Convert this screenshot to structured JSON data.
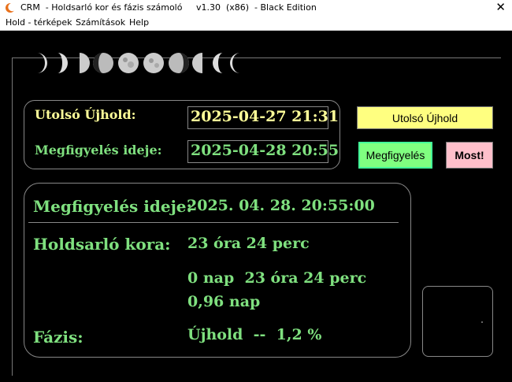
{
  "window": {
    "title": "CRM  - Holdsarló kor és fázis számoló     v1.30  (x86)  - Black Edition",
    "close": "✕"
  },
  "menu": [
    "Hold - térképek",
    "Számítások",
    "Help"
  ],
  "input_panel": {
    "last_new_moon_label": "Utolsó Újhold:",
    "last_new_moon_value": "2025-04-27 21:31",
    "observation_label": "Megfigyelés ideje:",
    "observation_value": "2025-04-28 20:55"
  },
  "buttons": {
    "last_new_moon": "Utolsó Újhold",
    "observation": "Megfigyelés",
    "now": "Most!"
  },
  "results": {
    "observation_label": "Megfigyelés ideje:",
    "observation_value": "2025. 04. 28. 20:55:00",
    "age_label": "Holdsarló kora:",
    "age_hours": "23 óra 24 perc",
    "age_days_hours": "0 nap  23 óra 24 perc",
    "age_days": "0,96 nap",
    "phase_label": "Fázis:",
    "phase_value": "Újhold  --  1,2 %"
  },
  "colors": {
    "yellow_button": "#ffff80",
    "green_button": "#80ff80",
    "pink_button": "#ffc0cb",
    "label_green": "#7fe07f",
    "label_yellow": "#ffff99"
  }
}
